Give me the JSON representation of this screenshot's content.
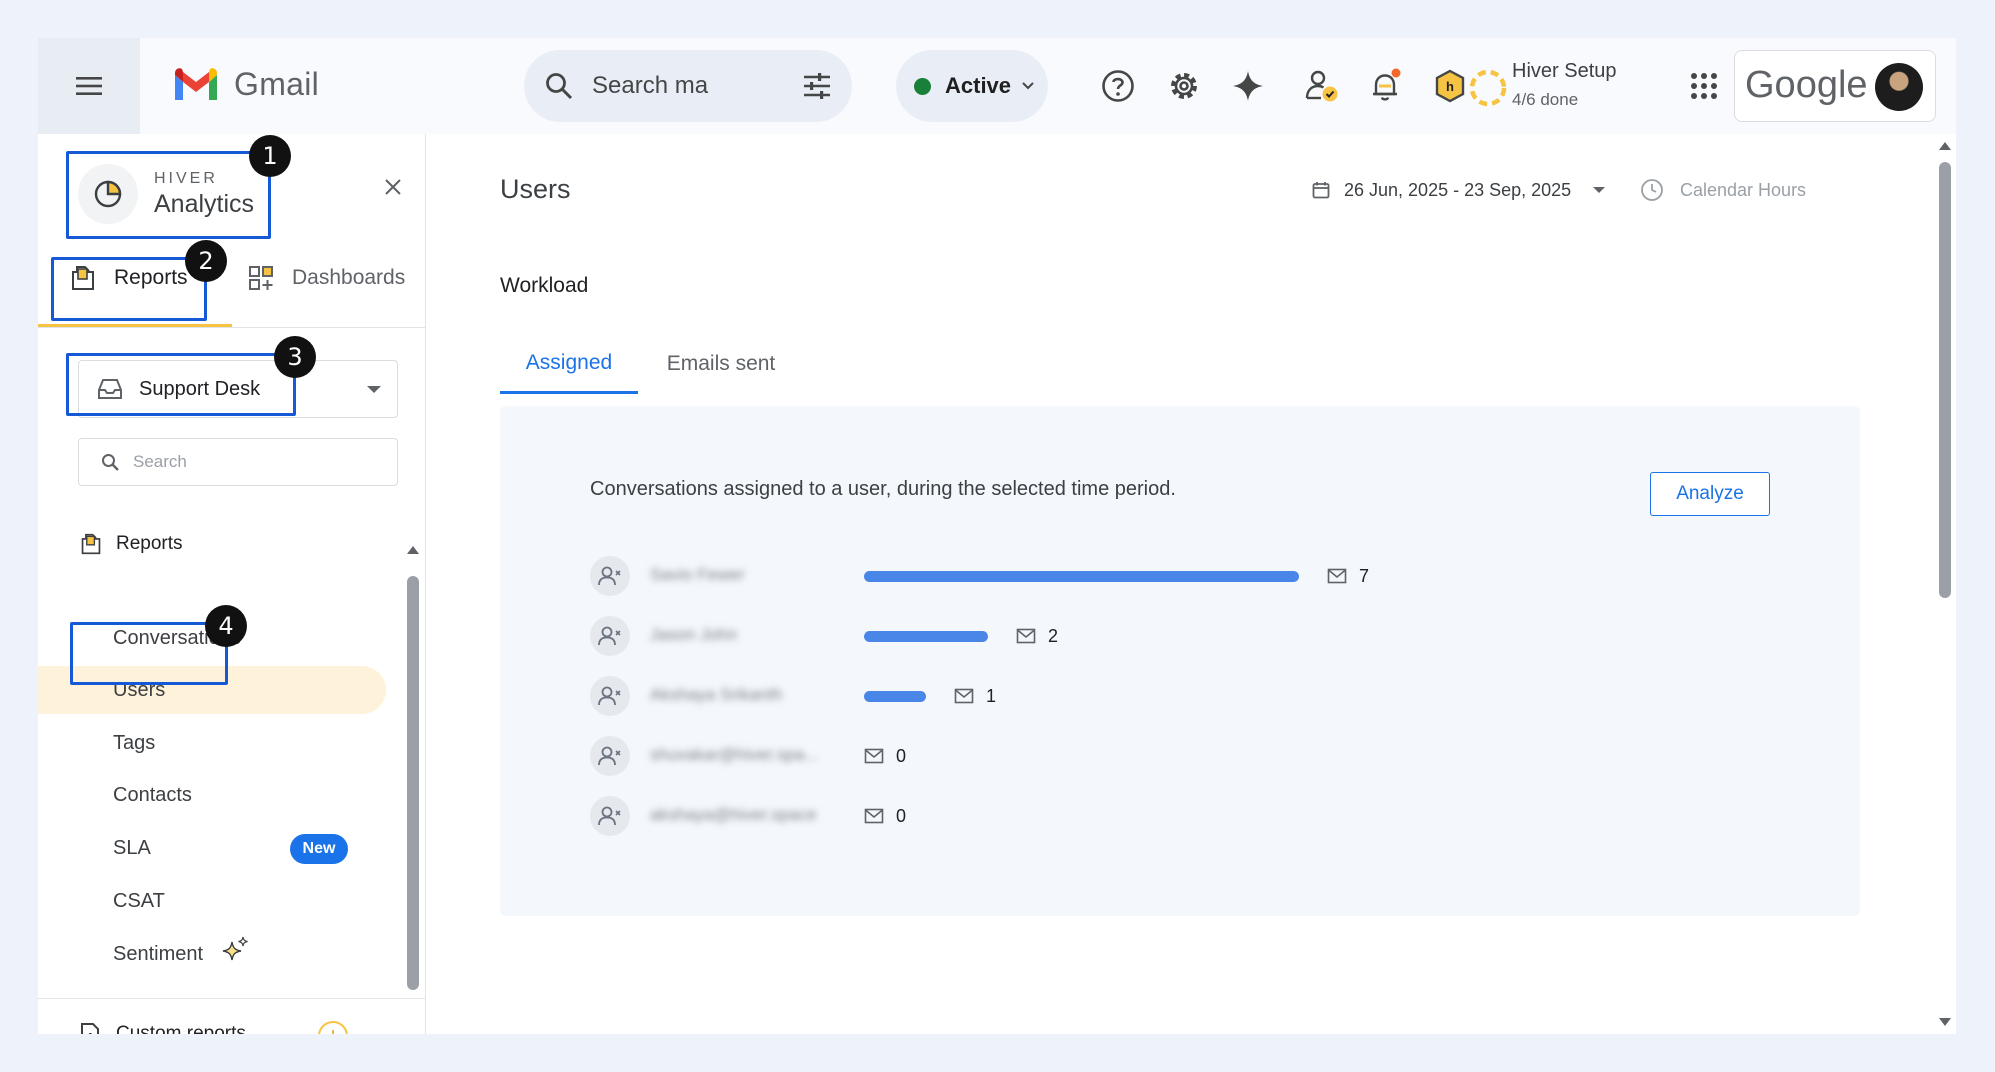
{
  "topbar": {
    "app_name": "Gmail",
    "search_placeholder": "Search ma",
    "status_label": "Active",
    "hiver_setup_title": "Hiver Setup",
    "hiver_setup_progress": "4/6 done",
    "google_label": "Google"
  },
  "sidebar": {
    "brand_hiver": "HIVER",
    "brand_analytics": "Analytics",
    "tab_reports": "Reports",
    "tab_dashboards": "Dashboards",
    "inbox_selected": "Support Desk",
    "search_placeholder": "Search",
    "section_label": "Reports",
    "items": [
      {
        "label": "Conversations"
      },
      {
        "label": "Users"
      },
      {
        "label": "Tags"
      },
      {
        "label": "Contacts"
      },
      {
        "label": "SLA"
      },
      {
        "label": "CSAT"
      },
      {
        "label": "Sentiment"
      }
    ],
    "new_badge": "New",
    "custom_reports": "Custom reports"
  },
  "main": {
    "title": "Users",
    "date_range": "26 Jun, 2025 - 23 Sep, 2025",
    "calendar_hours": "Calendar Hours",
    "section": "Workload",
    "tabs": [
      {
        "label": "Assigned"
      },
      {
        "label": "Emails sent"
      }
    ],
    "description": "Conversations assigned to a user, during the selected time period.",
    "analyze_label": "Analyze",
    "users": [
      {
        "name": "Savio Fewer",
        "count": "7",
        "value": 7
      },
      {
        "name": "Jason John",
        "count": "2",
        "value": 2
      },
      {
        "name": "Akshaya Srikanth",
        "count": "1",
        "value": 1
      },
      {
        "name": "shuvakar@hiver.spa...",
        "count": "0",
        "value": 0
      },
      {
        "name": "akshaya@hiver.space",
        "count": "0",
        "value": 0
      }
    ]
  },
  "annotations": [
    "1",
    "2",
    "3",
    "4"
  ],
  "colors": {
    "accent": "#1a73e8",
    "highlight": "#fef3da",
    "callout": "#1659d6",
    "bar": "#4a86e8"
  }
}
